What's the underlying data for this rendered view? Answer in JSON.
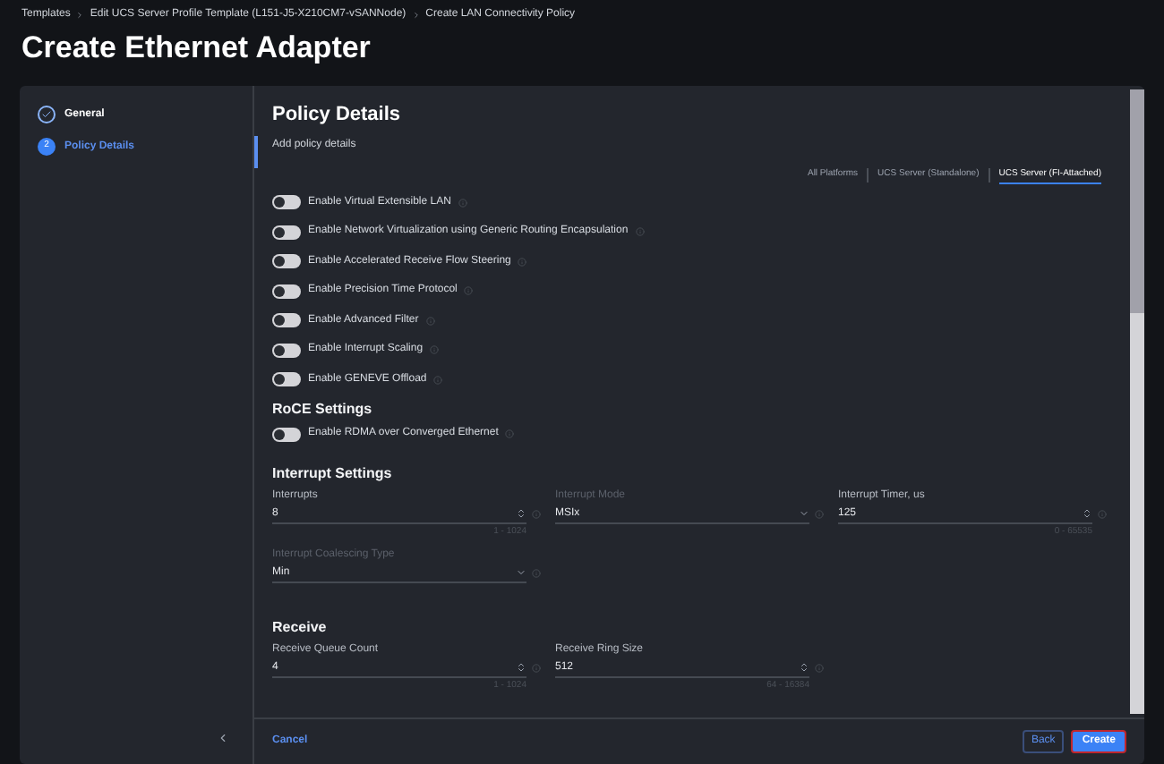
{
  "breadcrumbs": [
    "Templates",
    "Edit UCS Server Profile Template (L151-J5-X210CM7-vSANNode)",
    "Create LAN Connectivity Policy"
  ],
  "title": "Create Ethernet Adapter",
  "steps": [
    {
      "label": "General",
      "done": true,
      "selected": false
    },
    {
      "number": "2",
      "label": "Policy Details",
      "done": false,
      "selected": true
    }
  ],
  "heading": "Policy Details",
  "subheading": "Add policy details",
  "platform_tabs": [
    {
      "label": "All Platforms",
      "selected": false
    },
    {
      "label": "UCS Server (Standalone)",
      "selected": false
    },
    {
      "label": "UCS Server (FI-Attached)",
      "selected": true
    }
  ],
  "toggles": [
    {
      "label": "Enable Virtual Extensible LAN",
      "on": false
    },
    {
      "label": "Enable Network Virtualization using Generic Routing Encapsulation",
      "on": false
    },
    {
      "label": "Enable Accelerated Receive Flow Steering",
      "on": false
    },
    {
      "label": "Enable Precision Time Protocol",
      "on": false
    },
    {
      "label": "Enable Advanced Filter",
      "on": false
    },
    {
      "label": "Enable Interrupt Scaling",
      "on": false
    },
    {
      "label": "Enable GENEVE Offload",
      "on": false
    }
  ],
  "roce": {
    "title": "RoCE Settings",
    "toggles": [
      {
        "label": "Enable RDMA over Converged Ethernet",
        "on": false
      }
    ]
  },
  "interrupt": {
    "title": "Interrupt Settings",
    "rows": [
      [
        {
          "kind": "number",
          "label": "Interrupts",
          "value": "8",
          "range": "1 - 1024",
          "disabled": false
        },
        {
          "kind": "select",
          "label": "Interrupt Mode",
          "value": "MSIx",
          "disabled": true
        },
        {
          "kind": "number",
          "label": "Interrupt Timer, us",
          "value": "125",
          "range": "0 - 65535",
          "disabled": false
        }
      ],
      [
        {
          "kind": "select",
          "label": "Interrupt Coalescing Type",
          "value": "Min",
          "disabled": true
        }
      ]
    ]
  },
  "receive": {
    "title": "Receive",
    "rows": [
      [
        {
          "kind": "number",
          "label": "Receive Queue Count",
          "value": "4",
          "range": "1 - 1024",
          "disabled": false
        },
        {
          "kind": "number",
          "label": "Receive Ring Size",
          "value": "512",
          "range": "64 - 16384",
          "disabled": false
        }
      ]
    ]
  },
  "footer": {
    "cancel": "Cancel",
    "back": "Back",
    "create": "Create"
  }
}
